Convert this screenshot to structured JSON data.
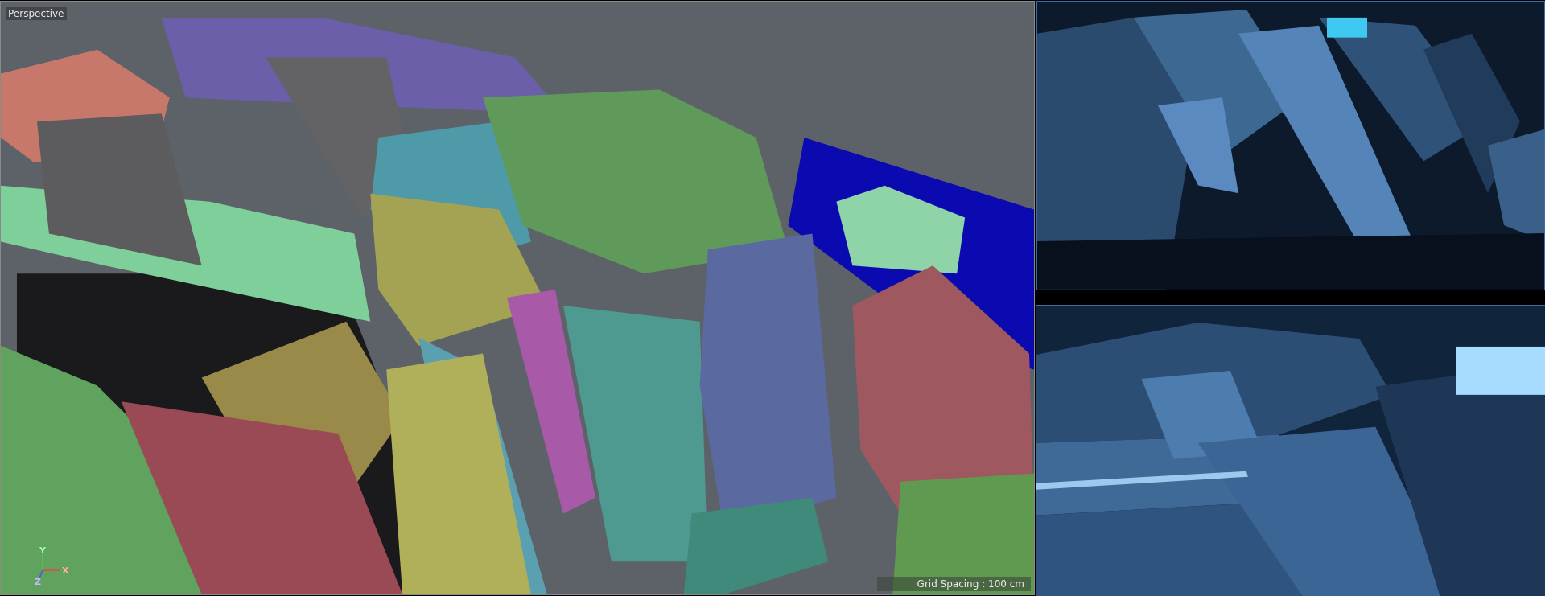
{
  "viewport": {
    "title": "Perspective",
    "axis_labels": [
      "Y",
      "X",
      "Z"
    ],
    "grid_spacing": "Grid Spacing : 100 cm"
  }
}
